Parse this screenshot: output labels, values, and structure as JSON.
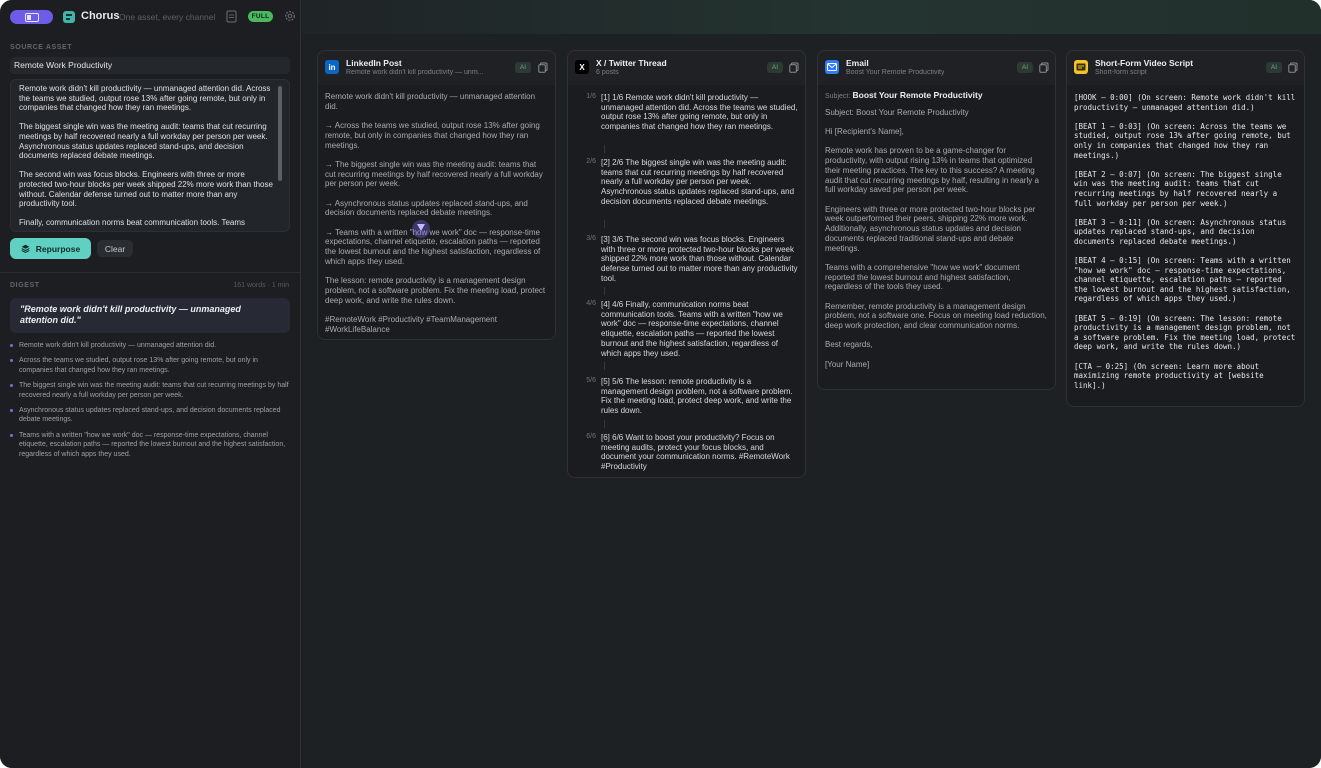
{
  "app": {
    "name": "Chorus",
    "tagline": "One asset, every channel",
    "mode_badge": "FULL"
  },
  "source": {
    "section_label": "SOURCE ASSET",
    "title": "Remote Work Productivity",
    "paragraphs": [
      "Remote work didn't kill productivity — unmanaged attention did. Across the teams we studied, output rose 13% after going remote, but only in companies that changed how they ran meetings.",
      "The biggest single win was the meeting audit: teams that cut recurring meetings by half recovered nearly a full workday per person per week. Asynchronous status updates replaced stand-ups, and decision documents replaced debate meetings.",
      "The second win was focus blocks. Engineers with three or more protected two-hour blocks per week shipped 22% more work than those without. Calendar defense turned out to matter more than any productivity tool.",
      "Finally, communication norms beat communication tools. Teams"
    ],
    "repurpose_label": "Repurpose",
    "clear_label": "Clear"
  },
  "digest": {
    "section_label": "DIGEST",
    "meta": "161 words · 1 min",
    "quote": "\"Remote work didn't kill productivity — unmanaged attention did.\"",
    "bullets": [
      "Remote work didn't kill productivity — unmanaged attention did.",
      "Across the teams we studied, output rose 13% after going remote, but only in companies that changed how they ran meetings.",
      "The biggest single win was the meeting audit: teams that cut recurring meetings by half recovered nearly a full workday per person per week.",
      "Asynchronous status updates replaced stand-ups, and decision documents replaced debate meetings.",
      "Teams with a written \"how we work\" doc — response-time expectations, channel etiquette, escalation paths — reported the lowest burnout and the highest satisfaction, regardless of which apps they used."
    ]
  },
  "cards": {
    "ai_label": "AI",
    "linkedin": {
      "title": "LinkedIn Post",
      "subtitle": "Remote work didn't kill productivity — unm...",
      "icon_text": "in",
      "paragraphs": [
        "Remote work didn't kill productivity — unmanaged attention did.",
        "→ Across the teams we studied, output rose 13% after going remote, but only in companies that changed how they ran meetings.",
        "→ The biggest single win was the meeting audit: teams that cut recurring meetings by half recovered nearly a full workday per person per week.",
        "→ Asynchronous status updates replaced stand-ups, and decision documents replaced debate meetings.",
        "→ Teams with a written \"how we work\" doc — response-time expectations, channel etiquette, escalation paths — reported the lowest burnout and the highest satisfaction, regardless of which apps they used.",
        "The lesson: remote productivity is a management design problem, not a software problem. Fix the meeting load, protect deep work, and write the rules down.",
        "#RemoteWork #Productivity #TeamManagement #WorkLifeBalance"
      ]
    },
    "twitter": {
      "title": "X / Twitter Thread",
      "subtitle": "6 posts",
      "icon_text": "X",
      "posts": [
        {
          "num": "1/6",
          "text": "[1] 1/6 Remote work didn't kill productivity — unmanaged attention did. Across the teams we studied, output rose 13% after going remote, but only in companies that changed how they ran meetings."
        },
        {
          "num": "2/6",
          "text": "[2] 2/6 The biggest single win was the meeting audit: teams that cut recurring meetings by half recovered nearly a full workday per person per week. Asynchronous status updates replaced stand-ups, and decision documents replaced debate meetings."
        },
        {
          "num": "3/6",
          "text": "[3] 3/6 The second win was focus blocks. Engineers with three or more protected two-hour blocks per week shipped 22% more work than those without. Calendar defense turned out to matter more than any productivity tool."
        },
        {
          "num": "4/6",
          "text": "[4] 4/6 Finally, communication norms beat communication tools. Teams with a written \"how we work\" doc — response-time expectations, channel etiquette, escalation paths — reported the lowest burnout and the highest satisfaction, regardless of which apps they used."
        },
        {
          "num": "5/6",
          "text": "[5] 5/6 The lesson: remote productivity is a management design problem, not a software problem. Fix the meeting load, protect deep work, and write the rules down."
        },
        {
          "num": "6/6",
          "text": "[6] 6/6 Want to boost your productivity? Focus on meeting audits, protect your focus blocks, and document your communication norms. #RemoteWork #Productivity"
        }
      ]
    },
    "email": {
      "title": "Email",
      "subtitle": "Boost Your Remote Productivity",
      "subject_label": "Subject:",
      "subject": "Boost Your Remote Productivity",
      "paragraphs": [
        "Subject: Boost Your Remote Productivity",
        "Hi [Recipient's Name],",
        "Remote work has proven to be a game-changer for productivity, with output rising 13% in teams that optimized their meeting practices. The key to this success? A meeting audit that cut recurring meetings by half, resulting in nearly a full workday saved per person per week.",
        "Engineers with three or more protected two-hour blocks per week outperformed their peers, shipping 22% more work. Additionally, asynchronous status updates and decision documents replaced traditional stand-ups and debate meetings.",
        "Teams with a comprehensive \"how we work\" document reported the lowest burnout and highest satisfaction, regardless of the tools they used.",
        "Remember, remote productivity is a management design problem, not a software one. Focus on meeting load reduction, deep work protection, and clear communication norms.",
        "Best regards,",
        "[Your Name]"
      ]
    },
    "script": {
      "title": "Short-Form Video Script",
      "subtitle": "Short-form script",
      "beats": [
        "[HOOK — 0:00] (On screen: Remote work didn't kill productivity — unmanaged attention did.)",
        "[BEAT 1 — 0:03] (On screen: Across the teams we studied, output rose 13% after going remote, but only in companies that changed how they ran meetings.)",
        "[BEAT 2 — 0:07] (On screen: The biggest single win was the meeting audit: teams that cut recurring meetings by half recovered nearly a full workday per person per week.)",
        "[BEAT 3 — 0:11] (On screen: Asynchronous status updates replaced stand-ups, and decision documents replaced debate meetings.)",
        "[BEAT 4 — 0:15] (On screen: Teams with a written \"how we work\" doc — response-time expectations, channel etiquette, escalation paths — reported the lowest burnout and the highest satisfaction, regardless of which apps they used.)",
        "[BEAT 5 — 0:19] (On screen: The lesson: remote productivity is a management design problem, not a software problem. Fix the meeting load, protect deep work, and write the rules down.)",
        "[CTA — 0:25] (On screen: Learn more about maximizing remote productivity at [website link].)"
      ]
    }
  },
  "colors": {
    "accent": "#6c5ce7",
    "teal": "#5fd0c2",
    "full_badge": "#49b861",
    "linkedin": "#0a66c2",
    "email": "#2f7df6",
    "script": "#f2c230"
  }
}
